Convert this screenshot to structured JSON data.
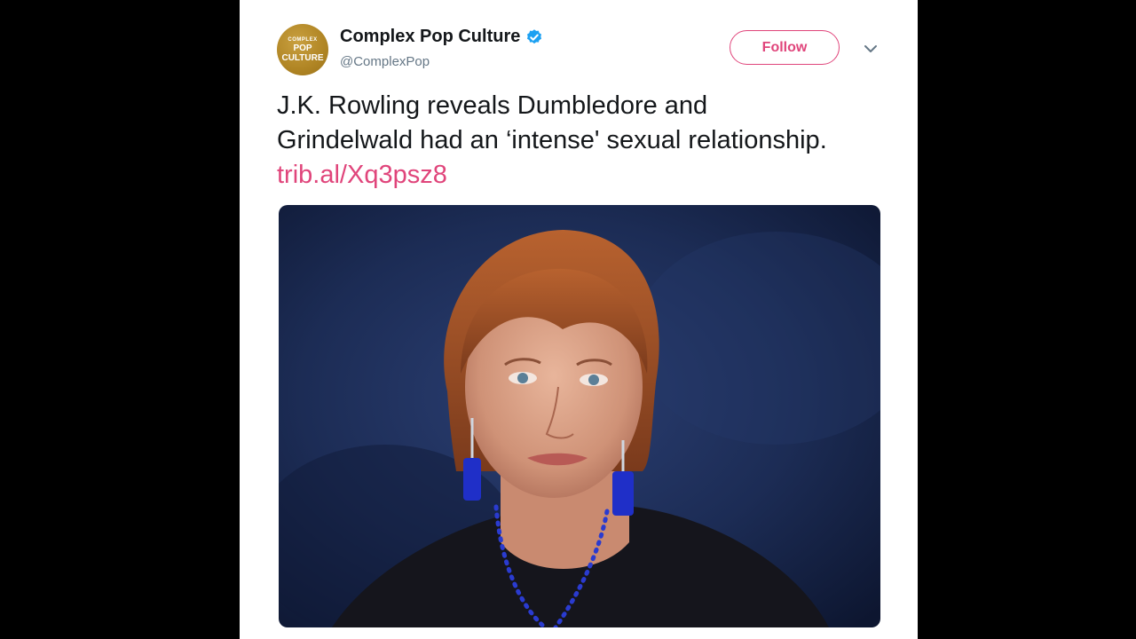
{
  "tweet": {
    "author": {
      "display_name": "Complex Pop Culture",
      "handle": "@ComplexPop",
      "verified": true,
      "avatar_text_top": "COMPLEX",
      "avatar_text_main": "POP CULTURE"
    },
    "follow_label": "Follow",
    "text_before_link": "J.K. Rowling reveals Dumbledore and Grindelwald had an ‘intense' sexual relationship. ",
    "link_text": "trib.al/Xq3psz8",
    "media": {
      "alt_icon": "photo-icon"
    }
  },
  "colors": {
    "accent": "#e0457b",
    "verified": "#1da1f2",
    "text": "#14171a",
    "muted": "#657786",
    "avatar_gold": "#b08524",
    "photo_background": "#1c2c55"
  }
}
